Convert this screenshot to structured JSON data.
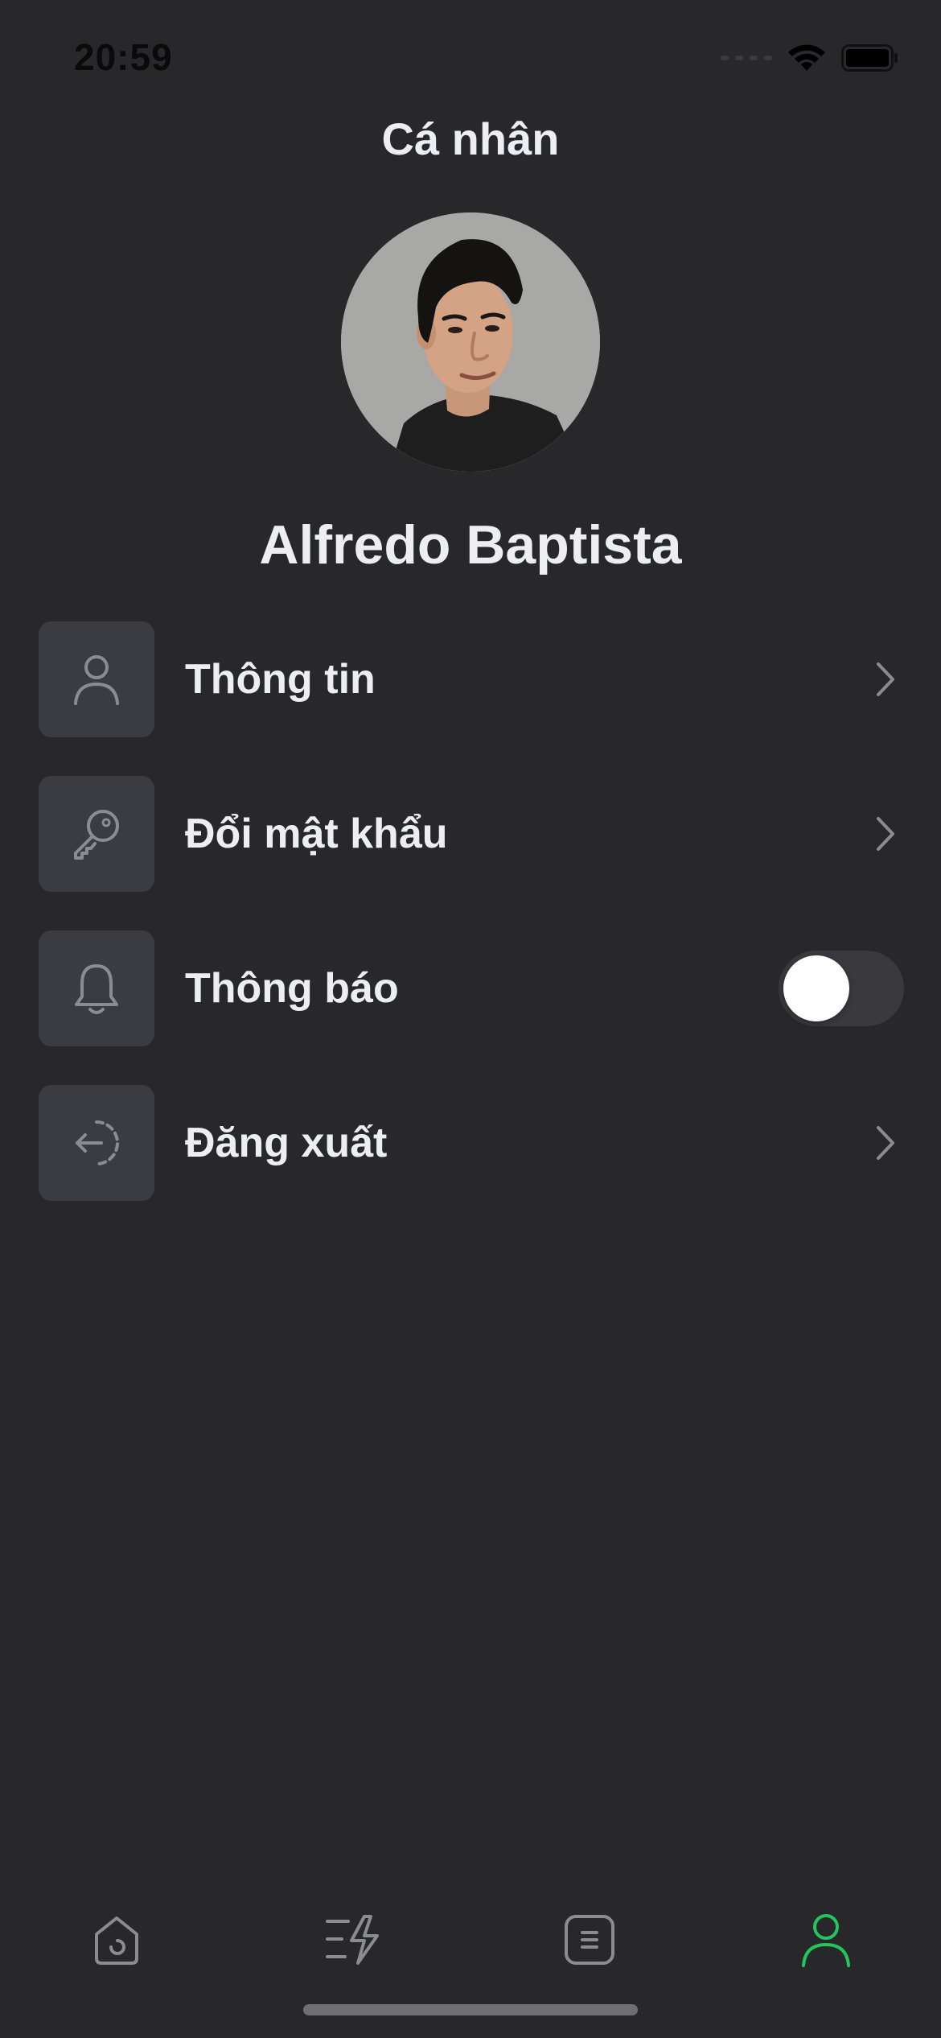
{
  "status_bar": {
    "time": "20:59"
  },
  "header": {
    "title": "Cá nhân"
  },
  "profile": {
    "name": "Alfredo Baptista"
  },
  "menu": {
    "items": [
      {
        "label": "Thông tin",
        "icon": "user-icon",
        "control": "chevron"
      },
      {
        "label": "Đổi mật khẩu",
        "icon": "key-icon",
        "control": "chevron"
      },
      {
        "label": "Thông báo",
        "icon": "bell-icon",
        "control": "toggle",
        "toggle_on": false
      },
      {
        "label": "Đăng xuất",
        "icon": "logout-icon",
        "control": "chevron"
      }
    ]
  },
  "tab_bar": {
    "tabs": [
      {
        "icon": "home-icon",
        "active": false
      },
      {
        "icon": "activity-icon",
        "active": false
      },
      {
        "icon": "document-icon",
        "active": false
      },
      {
        "icon": "profile-icon",
        "active": true
      }
    ]
  },
  "colors": {
    "background": "#28282b",
    "card": "#3b3c41",
    "text": "#eceef3",
    "icon_muted": "#8b8c92",
    "accent": "#22c55e"
  }
}
